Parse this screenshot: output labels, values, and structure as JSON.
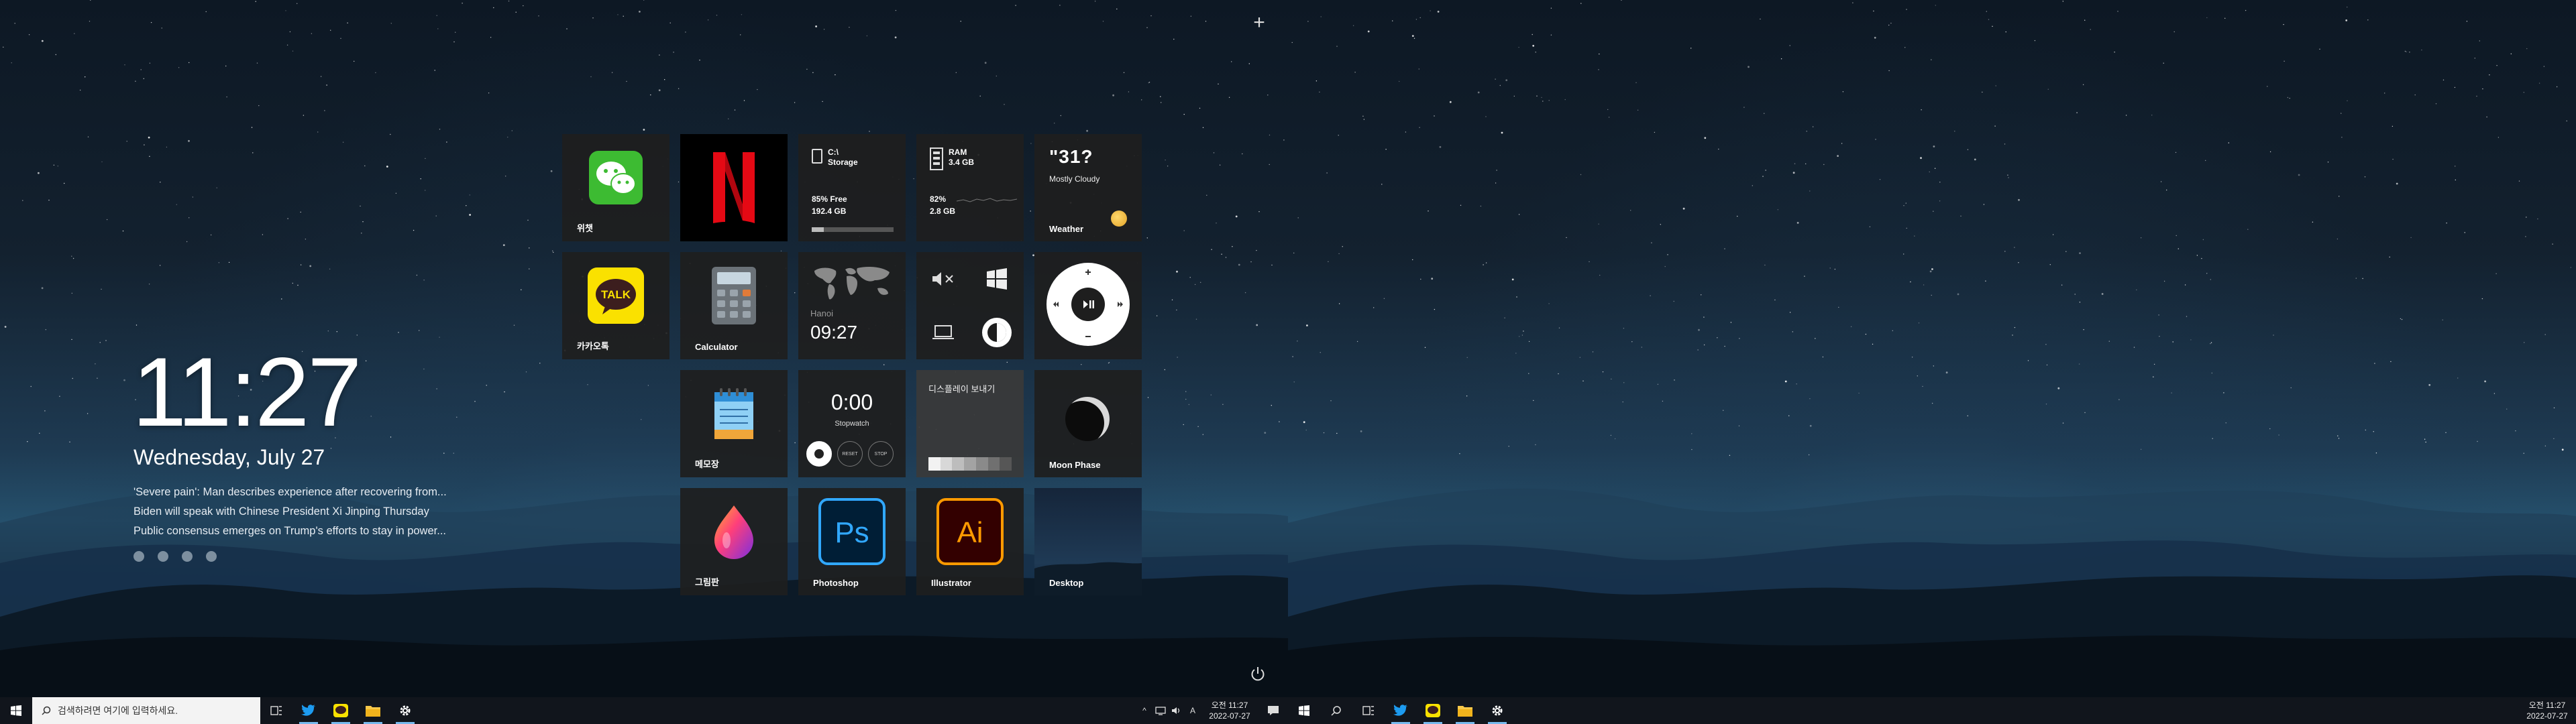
{
  "lock": {
    "time": "11:27",
    "date": "Wednesday, July 27",
    "news": [
      "'Severe pain': Man describes experience after recovering from...",
      "Biden will speak with Chinese President Xi Jinping Thursday",
      "Public consensus emerges on Trump's efforts to stay in power..."
    ],
    "page_dots": 4
  },
  "tiles": {
    "wechat": {
      "label": "위챗"
    },
    "netflix": {
      "logo": "N"
    },
    "storage": {
      "drive": "C:\\",
      "title": "Storage",
      "free_pct_text": "85% Free",
      "free_size": "192.4 GB",
      "used_fraction": 0.15
    },
    "ram": {
      "title": "RAM",
      "total": "3.4 GB",
      "pct_text": "82%",
      "used": "2.8 GB"
    },
    "weather": {
      "temp": "\"31?",
      "desc": "Mostly Cloudy",
      "label": "Weather"
    },
    "kakaotalk": {
      "label": "카카오톡",
      "logo": "TALK"
    },
    "calculator": {
      "label": "Calculator"
    },
    "worldclock": {
      "city": "Hanoi",
      "time": "09:27"
    },
    "quick_settings": {
      "icons": [
        "mute-icon",
        "windows-icon",
        "laptop-icon",
        "brightness-icon"
      ]
    },
    "media": {
      "icons": [
        "play-pause-icon"
      ]
    },
    "notepad": {
      "label": "메모장"
    },
    "stopwatch": {
      "time": "0:00",
      "label": "Stopwatch",
      "buttons": [
        "",
        "RESET",
        "STOP"
      ]
    },
    "display": {
      "title": "디스플레이 보내기"
    },
    "moon": {
      "label": "Moon Phase"
    },
    "paint": {
      "label": "그림판"
    },
    "photoshop": {
      "label": "Photoshop",
      "logo": "Ps"
    },
    "illustrator": {
      "label": "Illustrator",
      "logo": "Ai"
    },
    "desktop": {
      "label": "Desktop"
    }
  },
  "taskbar_left": {
    "search_placeholder": "검색하려면 여기에 입력하세요.",
    "clock_time": "오전 11:27",
    "clock_date": "2022-07-27",
    "tray_lang": "A"
  },
  "taskbar_right": {
    "clock_time": "오전 11:27",
    "clock_date": "2022-07-27"
  },
  "colors": {
    "taskbar_active": "#76b9ed",
    "wechat_green": "#3dbb32",
    "netflix_red": "#e50914",
    "kakao_yellow": "#fae100",
    "photoshop_blue": "#31a8ff",
    "illustrator_orange": "#ff9a00"
  }
}
